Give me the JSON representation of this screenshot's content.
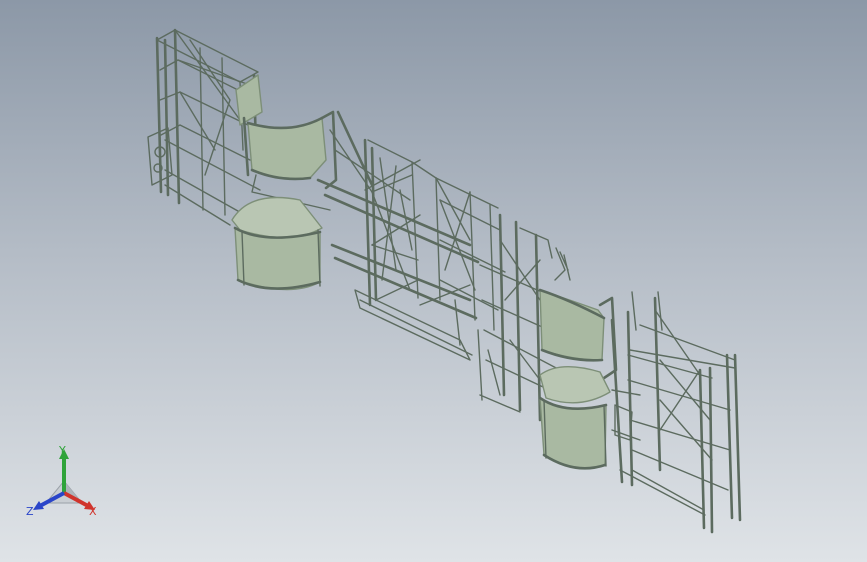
{
  "colors": {
    "frame": "#5c6b5f",
    "frame_light": "#b9c6b3",
    "panel": "#a9b9a2",
    "panel_dark": "#7d8f78",
    "axis_x": "#d0342c",
    "axis_y": "#2fa33a",
    "axis_z": "#2a45c9"
  },
  "triad": {
    "x_label": "X",
    "y_label": "Y",
    "z_label": "Z"
  }
}
